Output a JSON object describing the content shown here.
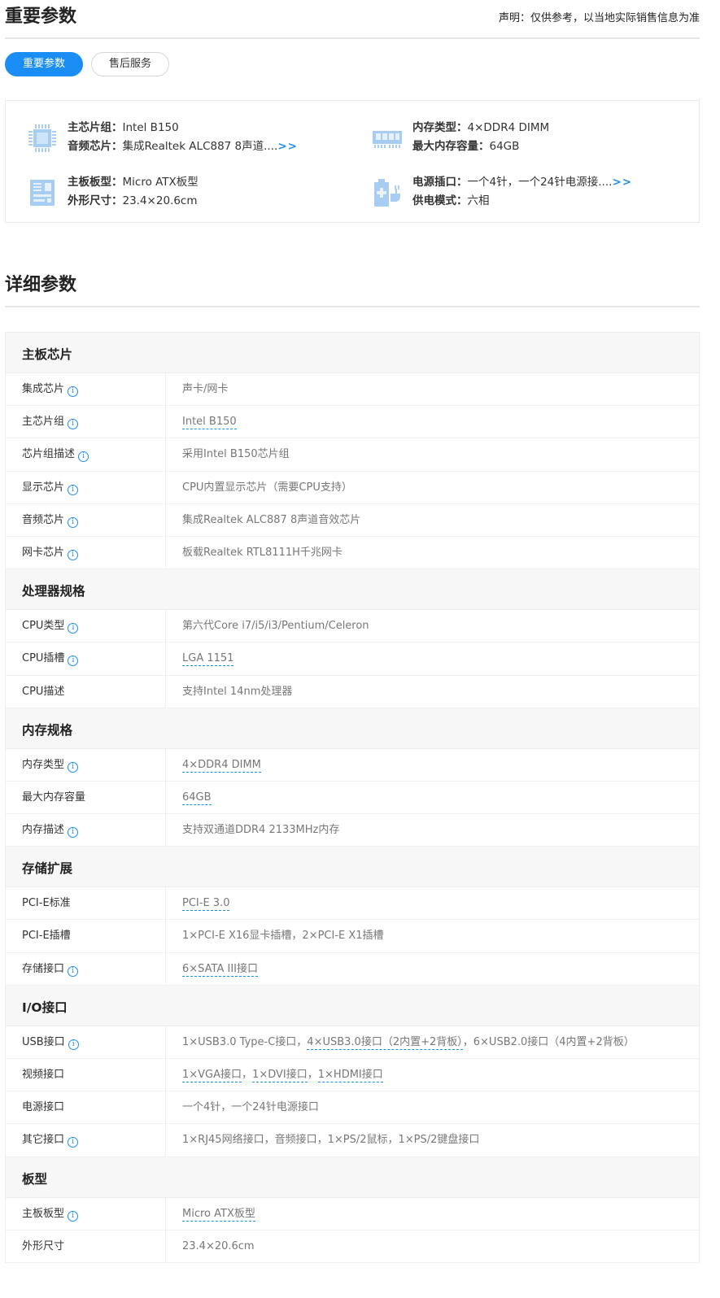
{
  "header": {
    "title": "重要参数",
    "disclaimer": "声明：仅供参考，以当地实际销售信息为准"
  },
  "tabs": [
    {
      "label": "重要参数",
      "active": true
    },
    {
      "label": "售后服务",
      "active": false
    }
  ],
  "summary": {
    "chipset": {
      "k1": "主芯片组：",
      "v1": "Intel B150",
      "k2": "音频芯片：",
      "v2": "集成Realtek ALC887 8声道....",
      "more": ">>"
    },
    "memory": {
      "k1": "内存类型：",
      "v1": "4×DDR4 DIMM",
      "k2": "最大内存容量：",
      "v2": "64GB"
    },
    "board": {
      "k1": "主板板型：",
      "v1": "Micro ATX板型",
      "k2": "外形尺寸：",
      "v2": "23.4×20.6cm"
    },
    "power": {
      "k1": "电源插口：",
      "v1": "一个4针，一个24针电源接....",
      "more": ">>",
      "k2": "供电模式：",
      "v2": "六相"
    }
  },
  "detail": {
    "title": "详细参数",
    "sections": [
      {
        "title": "主板芯片",
        "rows": [
          {
            "label": "集成芯片",
            "info": true,
            "parts": [
              {
                "t": "声卡/网卡"
              }
            ]
          },
          {
            "label": "主芯片组",
            "info": true,
            "parts": [
              {
                "t": "Intel B150",
                "link": true
              }
            ]
          },
          {
            "label": "芯片组描述",
            "info": true,
            "parts": [
              {
                "t": "采用Intel B150芯片组"
              }
            ]
          },
          {
            "label": "显示芯片",
            "info": true,
            "parts": [
              {
                "t": "CPU内置显示芯片（需要CPU支持）"
              }
            ]
          },
          {
            "label": "音频芯片",
            "info": true,
            "parts": [
              {
                "t": "集成Realtek ALC887 8声道音效芯片"
              }
            ]
          },
          {
            "label": "网卡芯片",
            "info": true,
            "parts": [
              {
                "t": "板载Realtek RTL8111H千兆网卡"
              }
            ]
          }
        ]
      },
      {
        "title": "处理器规格",
        "rows": [
          {
            "label": "CPU类型",
            "info": true,
            "parts": [
              {
                "t": "第六代Core i7/i5/i3/Pentium/Celeron"
              }
            ]
          },
          {
            "label": "CPU插槽",
            "info": true,
            "parts": [
              {
                "t": "LGA 1151",
                "link": true
              }
            ]
          },
          {
            "label": "CPU描述",
            "info": false,
            "parts": [
              {
                "t": "支持Intel 14nm处理器"
              }
            ]
          }
        ]
      },
      {
        "title": "内存规格",
        "rows": [
          {
            "label": "内存类型",
            "info": true,
            "parts": [
              {
                "t": "4×DDR4 DIMM",
                "link": true
              }
            ]
          },
          {
            "label": "最大内存容量",
            "info": false,
            "parts": [
              {
                "t": "64GB",
                "link": true
              }
            ]
          },
          {
            "label": "内存描述",
            "info": true,
            "parts": [
              {
                "t": "支持双通道DDR4 2133MHz内存"
              }
            ]
          }
        ]
      },
      {
        "title": "存储扩展",
        "rows": [
          {
            "label": "PCI-E标准",
            "info": false,
            "parts": [
              {
                "t": "PCI-E 3.0",
                "link": true
              }
            ]
          },
          {
            "label": "PCI-E插槽",
            "info": false,
            "parts": [
              {
                "t": "1×PCI-E X16显卡插槽，2×PCI-E X1插槽"
              }
            ]
          },
          {
            "label": "存储接口",
            "info": true,
            "parts": [
              {
                "t": "6×SATA III接口",
                "link": true
              }
            ]
          }
        ]
      },
      {
        "title": "I/O接口",
        "rows": [
          {
            "label": "USB接口",
            "info": true,
            "parts": [
              {
                "t": "1×USB3.0 Type-C接口，"
              },
              {
                "t": "4×USB3.0接口（2内置+2背板）",
                "link": true
              },
              {
                "t": "，6×USB2.0接口（4内置+2背板）"
              }
            ]
          },
          {
            "label": "视频接口",
            "info": false,
            "parts": [
              {
                "t": "1×VGA接口",
                "link": true
              },
              {
                "t": "，"
              },
              {
                "t": "1×DVI接口",
                "link": true
              },
              {
                "t": "，"
              },
              {
                "t": "1×HDMI接口",
                "link": true
              }
            ]
          },
          {
            "label": "电源接口",
            "info": false,
            "parts": [
              {
                "t": "一个4针，一个24针电源接口"
              }
            ]
          },
          {
            "label": "其它接口",
            "info": true,
            "parts": [
              {
                "t": "1×RJ45网络接口，音频接口，1×PS/2鼠标，1×PS/2键盘接口"
              }
            ]
          }
        ]
      },
      {
        "title": "板型",
        "rows": [
          {
            "label": "主板板型",
            "info": true,
            "parts": [
              {
                "t": "Micro ATX板型",
                "link": true
              }
            ]
          },
          {
            "label": "外形尺寸",
            "info": false,
            "parts": [
              {
                "t": "23.4×20.6cm"
              }
            ]
          }
        ]
      }
    ]
  },
  "icons": {
    "info_glyph": "i",
    "accent": "#1b8ef5",
    "icon_color": "#a8cdf3"
  }
}
